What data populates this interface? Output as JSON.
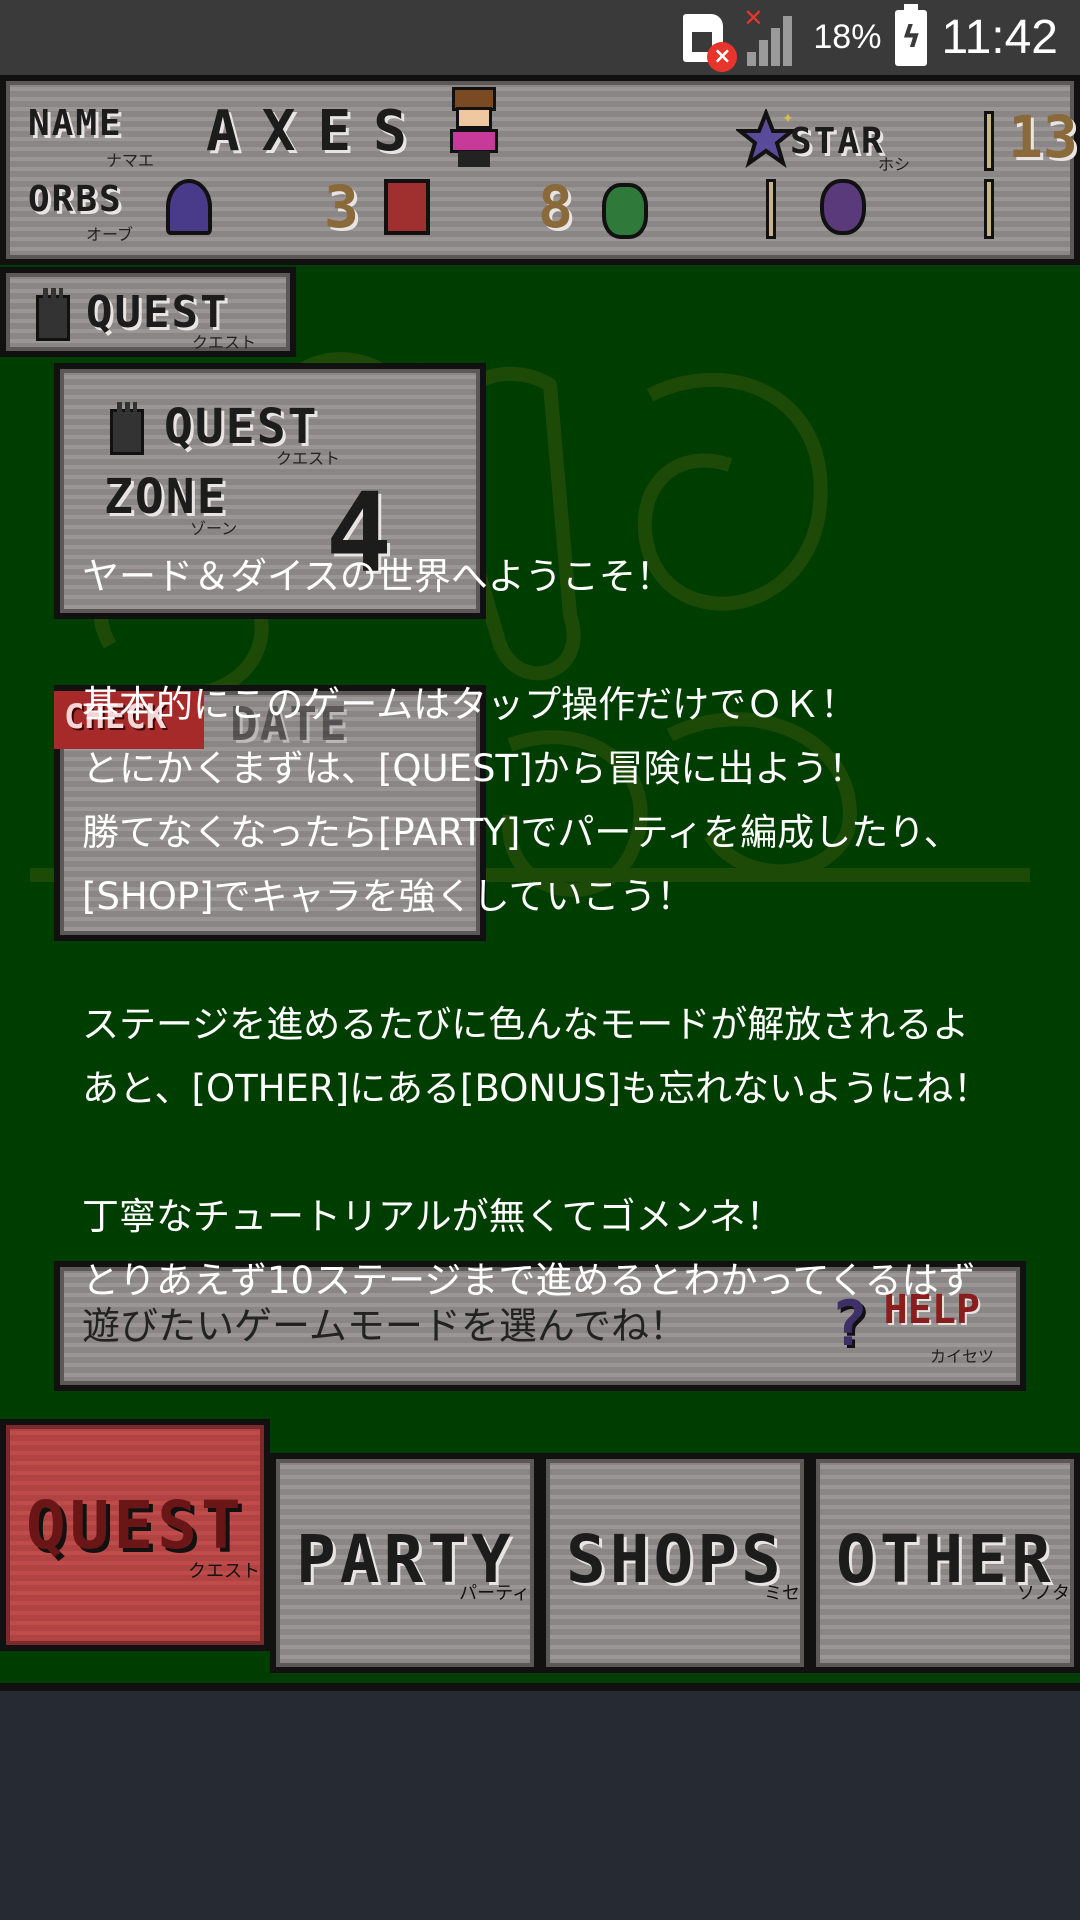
{
  "status_bar": {
    "battery_percent": "18%",
    "time": "11:42",
    "icons": [
      "sim-error-icon",
      "signal-no-service-icon",
      "battery-charging-icon"
    ]
  },
  "header": {
    "name_label": "NAME",
    "name_label_kana": "ナマエ",
    "player_name": "AXES",
    "orbs_label": "ORBS",
    "orbs_label_kana": "オーブ",
    "orbs": [
      {
        "icon": "blue-flame-orb-icon",
        "color": "#4a3a8a",
        "count": "3"
      },
      {
        "icon": "red-castle-orb-icon",
        "color": "#a03030",
        "count": "8"
      },
      {
        "icon": "green-leaf-orb-icon",
        "color": "#2f7a3a",
        "count": "1"
      },
      {
        "icon": "purple-skull-orb-icon",
        "color": "#5a3a7a",
        "count": "1"
      }
    ],
    "star_label": "STAR",
    "star_label_kana": "ホシ",
    "star_count": "13"
  },
  "quest_tab": {
    "label": "QUEST",
    "kana": "クエスト"
  },
  "zone_panel": {
    "label1": "QUEST",
    "kana1": "クエスト",
    "label2": "ZONE",
    "kana2": "ゾーン",
    "number": "4"
  },
  "check_panel": {
    "flag": "CHECK",
    "label": "DATE"
  },
  "help_bar": {
    "text": "遊びたいゲームモードを選んでね！",
    "help_label": "HELP",
    "help_kana": "カイセツ"
  },
  "nav": [
    {
      "label": "QUEST",
      "kana": "クエスト"
    },
    {
      "label": "PARTY",
      "kana": "パーティ"
    },
    {
      "label": "SHOPS",
      "kana": "ミセ"
    },
    {
      "label": "OTHER",
      "kana": "ソノタ"
    }
  ],
  "dialog": {
    "lines": [
      "ヤード＆ダイスの世界へようこそ！",
      "",
      "基本的にこのゲームはタップ操作だけでＯＫ！",
      "とにかくまずは、[QUEST]から冒険に出よう！",
      "勝てなくなったら[PARTY]でパーティを編成したり、",
      "[SHOP]でキャラを強くしていこう！",
      "",
      "ステージを進めるたびに色んなモードが解放されるよ",
      "あと、[OTHER]にある[BONUS]も忘れないようにね！",
      "",
      "丁寧なチュートリアルが無くてゴメンネ！",
      "とりあえず10ステージまで進めるとわかってくるはず"
    ]
  },
  "colors": {
    "background_green": "#003d00",
    "panel_gray": "#9a9696",
    "quest_active_red": "#c04b4b",
    "outline": "#111111"
  }
}
